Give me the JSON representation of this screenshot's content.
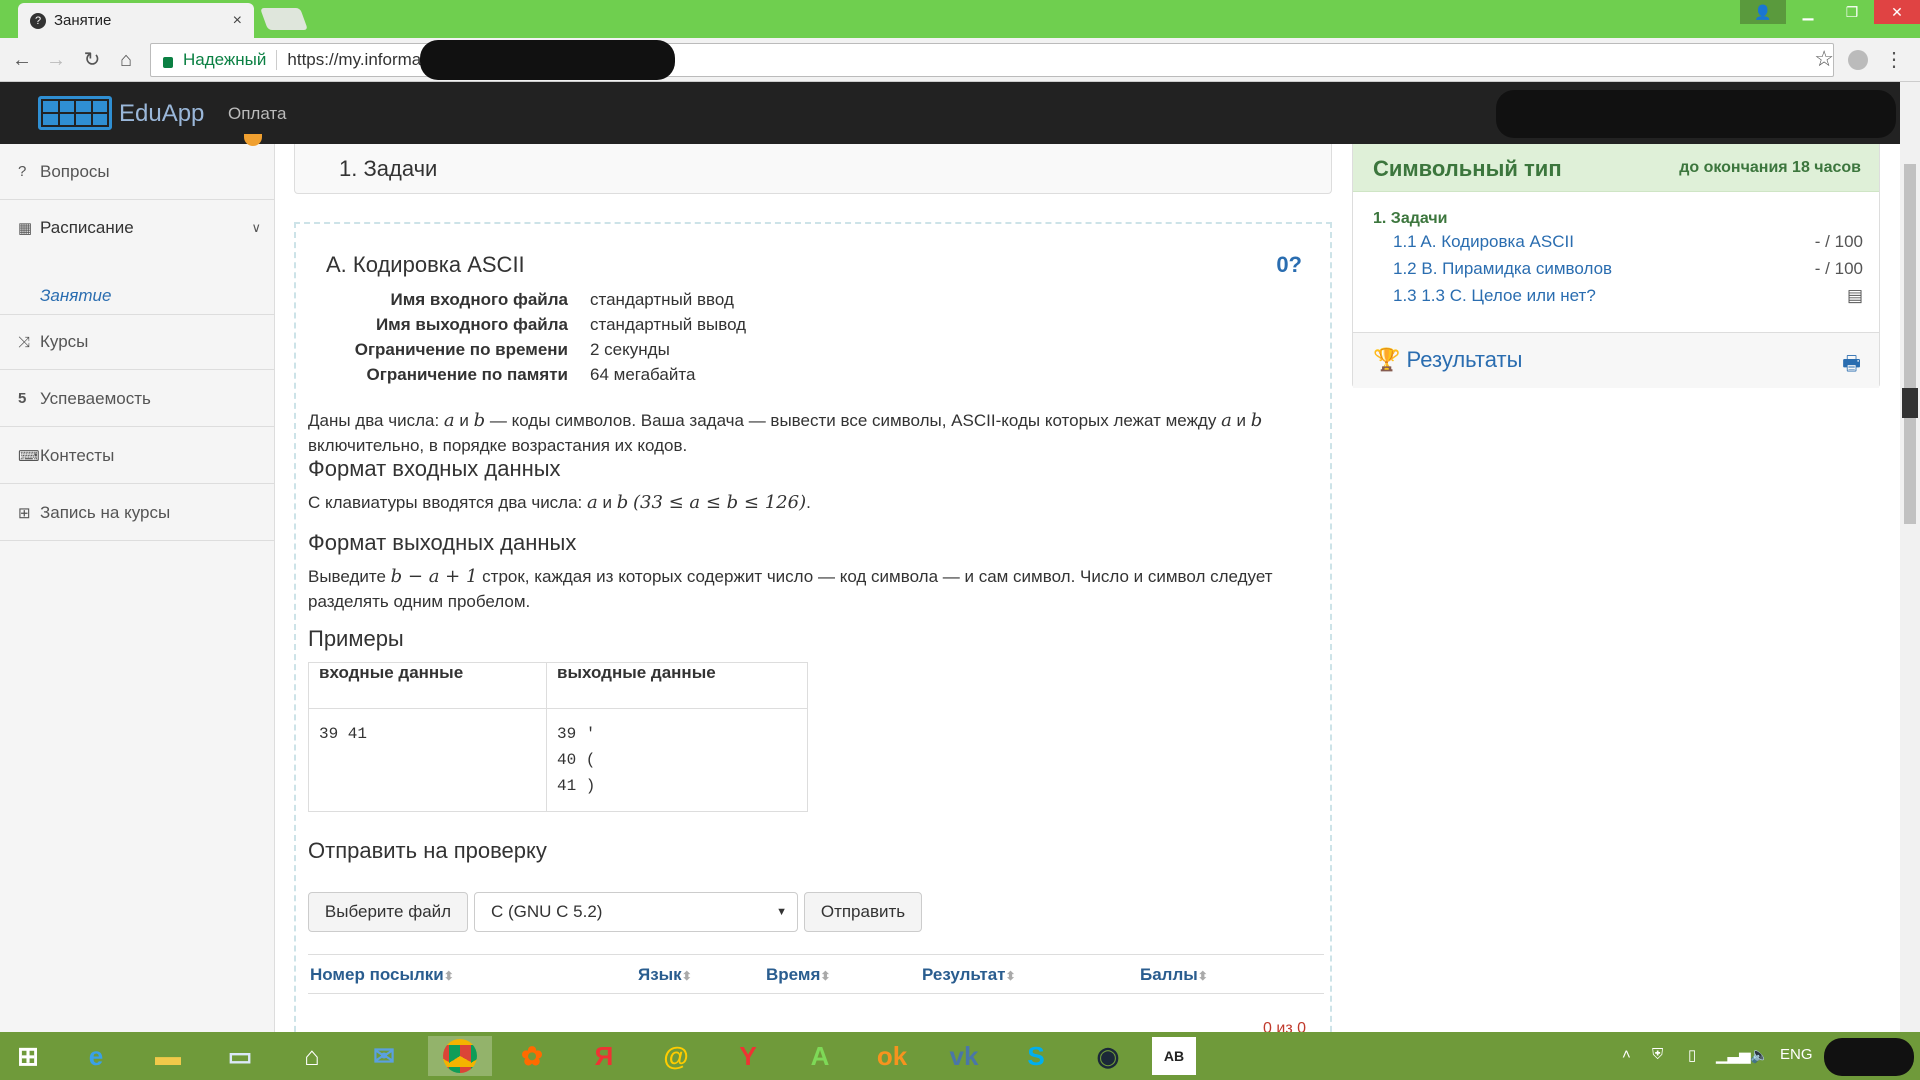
{
  "browser": {
    "tab_title": "Занятие",
    "tab_close": "×",
    "secure_label": "Надежный",
    "url": "https://my.informatics"
  },
  "app": {
    "brand": "EduApp",
    "nav_link": "Оплата"
  },
  "sidebar": {
    "items": [
      {
        "icon": "?",
        "label": "Вопросы"
      },
      {
        "icon": "▦",
        "label": "Расписание"
      },
      {
        "icon": "⤨",
        "label": "Курсы"
      },
      {
        "icon": "5",
        "label": "Успеваемость"
      },
      {
        "icon": "⌨",
        "label": "Контесты"
      },
      {
        "icon": "⊞",
        "label": "Запись на курсы"
      }
    ],
    "sub_item": "Занятие"
  },
  "main": {
    "section_title": "1. Задачи",
    "problem_title": "A. Кодировка ASCII",
    "problem_mark": "0?",
    "limits": [
      {
        "k": "Имя входного файла",
        "v": "стандартный ввод"
      },
      {
        "k": "Имя выходного файла",
        "v": "стандартный вывод"
      },
      {
        "k": "Ограничение по времени",
        "v": "2 секунды"
      },
      {
        "k": "Ограничение по памяти",
        "v": "64 мегабайта"
      }
    ],
    "statement_1": "Даны два числа: ",
    "statement_a": "a",
    "statement_and": " и ",
    "statement_b": "b",
    "statement_2": " — коды символов. Ваша задача — вывести все символы, ASCII-коды которых лежат между ",
    "statement_3": "включительно, в порядке возрастания их кодов.",
    "input_heading": "Формат входных данных",
    "input_text": "С клавиатуры вводятся два числа: ",
    "input_math": "(33 ≤ a ≤ b ≤ 126)",
    "output_heading": "Формат выходных данных",
    "output_text_1": "Выведите ",
    "output_math": "b − a + 1",
    "output_text_2": " строк, каждая из которых содержит число — код символа — и сам символ. Число и символ следует",
    "output_text_3": "разделять одним пробелом.",
    "examples_heading": "Примеры",
    "examples": {
      "input_header": "входные данные",
      "output_header": "выходные данные",
      "input": "39 41",
      "output": "39 '\n40 (\n41 )"
    },
    "submit_heading": "Отправить на проверку",
    "choose_file": "Выберите файл",
    "language": "C (GNU C 5.2)",
    "send": "Отправить",
    "columns": [
      "Номер посылки",
      "Язык",
      "Время",
      "Результат",
      "Баллы"
    ],
    "count": "0 из 0"
  },
  "right": {
    "title": "Символьный тип",
    "deadline": "до окончания 18 часов",
    "section": "1. Задачи",
    "items": [
      {
        "label": "1.1 A. Кодировка ASCII",
        "score": "- / 100"
      },
      {
        "label": "1.2 B. Пирамидка символов",
        "score": "- / 100"
      },
      {
        "label": "1.3 1.3 C. Целое или нет?",
        "score": "▤"
      }
    ],
    "results": "Результаты"
  },
  "taskbar": {
    "lang": "ENG"
  },
  "colors": {
    "tabbar": "#6fcf4f",
    "taskbar": "#6f9a3a",
    "navbar": "#222222",
    "accent": "#2a6db0",
    "success": "#3c763d"
  }
}
